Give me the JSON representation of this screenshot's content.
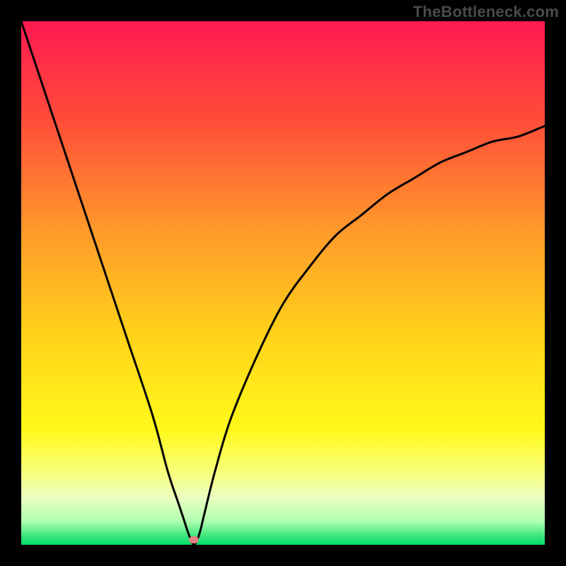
{
  "watermark": "TheBottleneck.com",
  "colors": {
    "frame": "#000000",
    "watermark": "#4a4a4a",
    "curve": "#000000",
    "marker": "#e08080",
    "gradient_stops": [
      {
        "offset": 0.0,
        "color": "#ff1a52"
      },
      {
        "offset": 0.18,
        "color": "#ff4a3a"
      },
      {
        "offset": 0.4,
        "color": "#ff9a2a"
      },
      {
        "offset": 0.6,
        "color": "#ffd21a"
      },
      {
        "offset": 0.78,
        "color": "#fff91a"
      },
      {
        "offset": 0.86,
        "color": "#f8ff7a"
      },
      {
        "offset": 0.91,
        "color": "#eaffc0"
      },
      {
        "offset": 0.955,
        "color": "#b0ffb0"
      },
      {
        "offset": 0.985,
        "color": "#35e57a"
      },
      {
        "offset": 1.0,
        "color": "#00dd66"
      }
    ]
  },
  "chart_data": {
    "type": "line",
    "title": "",
    "xlabel": "",
    "ylabel": "",
    "xlim": [
      0,
      100
    ],
    "ylim": [
      0,
      100
    ],
    "grid": false,
    "legend": false,
    "marker": {
      "x": 33,
      "y": 1
    },
    "series": [
      {
        "name": "bottleneck-curve",
        "x": [
          0,
          5,
          10,
          15,
          20,
          25,
          28,
          30,
          31,
          32,
          33,
          34,
          35,
          37,
          40,
          45,
          50,
          55,
          60,
          65,
          70,
          75,
          80,
          85,
          90,
          95,
          100
        ],
        "y": [
          100,
          85,
          70,
          55,
          40,
          25,
          14,
          8,
          5,
          2,
          0,
          2,
          6,
          14,
          24,
          36,
          46,
          53,
          59,
          63,
          67,
          70,
          73,
          75,
          77,
          78,
          80
        ]
      }
    ]
  }
}
